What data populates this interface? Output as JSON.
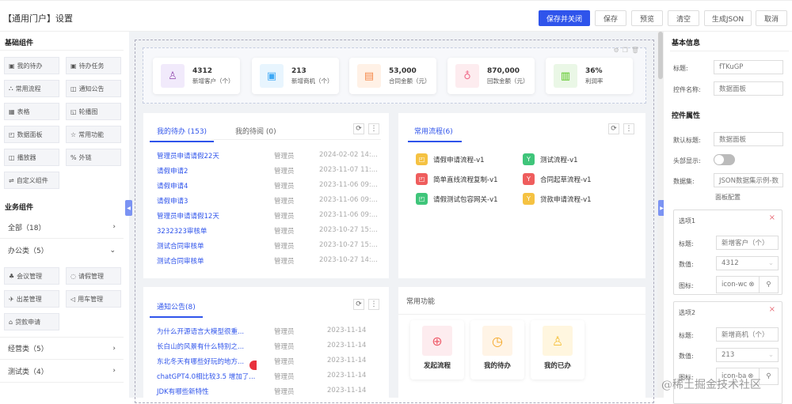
{
  "header": {
    "title": "【通用门户】设置",
    "buttons": [
      "保存并关闭",
      "保存",
      "预览",
      "清空",
      "生成JSON",
      "取消"
    ]
  },
  "sidebar": {
    "basic_title": "基础组件",
    "basic": [
      "我的待办",
      "待办任务",
      "常用流程",
      "通知公告",
      "表格",
      "轮播图",
      "数据面板",
      "常用功能",
      "播放器",
      "外链",
      "自定义组件"
    ],
    "biz_title": "业务组件",
    "groups": [
      {
        "label": "全部（18）"
      },
      {
        "label": "办公类（5）"
      },
      {
        "label": "经营类（5）"
      },
      {
        "label": "测试类（4）"
      }
    ],
    "office": [
      "会议管理",
      "请假管理",
      "出差管理",
      "用车管理",
      "贷款申请"
    ]
  },
  "stats": [
    {
      "value": "4312",
      "label": "新增客户（个）",
      "color": "#9b59b6",
      "bg": "#f1eafb",
      "icon": "user-icon"
    },
    {
      "value": "213",
      "label": "新增商机（个）",
      "color": "#3fa9f5",
      "bg": "#e8f5fe",
      "icon": "box-icon"
    },
    {
      "value": "53,000",
      "label": "合同金额（元）",
      "color": "#f5894b",
      "bg": "#fff1e6",
      "icon": "document-icon"
    },
    {
      "value": "870,000",
      "label": "回款金额（元）",
      "color": "#f06b8a",
      "bg": "#fdecef",
      "icon": "money-bag-icon"
    },
    {
      "value": "36%",
      "label": "利润率",
      "color": "#52c41a",
      "bg": "#eaf7e6",
      "icon": "chart-icon"
    }
  ],
  "todo": {
    "tabs": [
      "我的待办 (153)",
      "我的待阅 (0)"
    ],
    "rows": [
      [
        "管理员申请请假22天",
        "管理员",
        "2024-02-02 14:..."
      ],
      [
        "请假申请2",
        "管理员",
        "2023-11-07 11:..."
      ],
      [
        "请假申请4",
        "管理员",
        "2023-11-06 09:..."
      ],
      [
        "请假申请3",
        "管理员",
        "2023-11-06 09:..."
      ],
      [
        "管理员申请请假12天",
        "管理员",
        "2023-11-06 09:..."
      ],
      [
        "3232323审核单",
        "管理员",
        "2023-10-27 15:..."
      ],
      [
        "测试合同审核单",
        "管理员",
        "2023-10-27 15:..."
      ],
      [
        "测试合同审核单",
        "管理员",
        "2023-10-27 14:..."
      ]
    ]
  },
  "process": {
    "tab": "常用流程(6)",
    "items": [
      {
        "label": "请假申请流程-v1",
        "color": "#f5c242"
      },
      {
        "label": "测试流程-v1",
        "color": "#3fc57a"
      },
      {
        "label": "简单直线流程复制-v1",
        "color": "#ef5d5d"
      },
      {
        "label": "合同起草流程-v1",
        "color": "#ef5d5d"
      },
      {
        "label": "请假测试包容网关-v1",
        "color": "#3fc57a"
      },
      {
        "label": "贷款申请流程-v1",
        "color": "#f5c242"
      }
    ]
  },
  "notice": {
    "tab": "通知公告(8)",
    "rows": [
      [
        "为什么开源语言大模型很重...",
        "管理员",
        "2023-11-14"
      ],
      [
        "长白山的风景有什么特别之...",
        "管理员",
        "2023-11-14"
      ],
      [
        "东北冬天有哪些好玩的地方...",
        "管理员",
        "2023-11-14"
      ],
      [
        "chatGPT4.0相比较3.5 增加了...",
        "管理员",
        "2023-11-14"
      ],
      [
        "JDK有哪些新特性",
        "管理员",
        "2023-11-14"
      ]
    ]
  },
  "functions": {
    "title": "常用功能",
    "items": [
      {
        "label": "发起流程",
        "color": "#ef5d6b",
        "bg": "#fdecef",
        "icon": "plus-circle-icon"
      },
      {
        "label": "我的待办",
        "color": "#f5a623",
        "bg": "#fff4e6",
        "icon": "clock-icon"
      },
      {
        "label": "我的已办",
        "color": "#f5c242",
        "bg": "#fff6df",
        "icon": "user-check-icon"
      }
    ]
  },
  "right": {
    "basic_title": "基本信息",
    "title_label": "标题:",
    "title_value": "fTKuGP",
    "name_label": "控件名称:",
    "name_value": "数据面板",
    "prop_title": "控件属性",
    "default_title_label": "默认标题:",
    "default_title_value": "数据面板",
    "header_show_label": "头部显示:",
    "header_show": false,
    "dataset_label": "数据集:",
    "dataset_value": "JSON数据集示例-数",
    "panel_config": "面板配置",
    "options": [
      {
        "name": "选项1",
        "title_label": "标题:",
        "title": "新增客户（个）",
        "value_label": "数值:",
        "value": "4312",
        "icon_label": "图标:",
        "icon": "icon-wc"
      },
      {
        "name": "选项2",
        "title_label": "标题:",
        "title": "新增商机（个）",
        "value_label": "数值:",
        "value": "213",
        "icon_label": "图标:",
        "icon": "icon-ba"
      }
    ]
  },
  "watermark": "@稀土掘金技术社区"
}
